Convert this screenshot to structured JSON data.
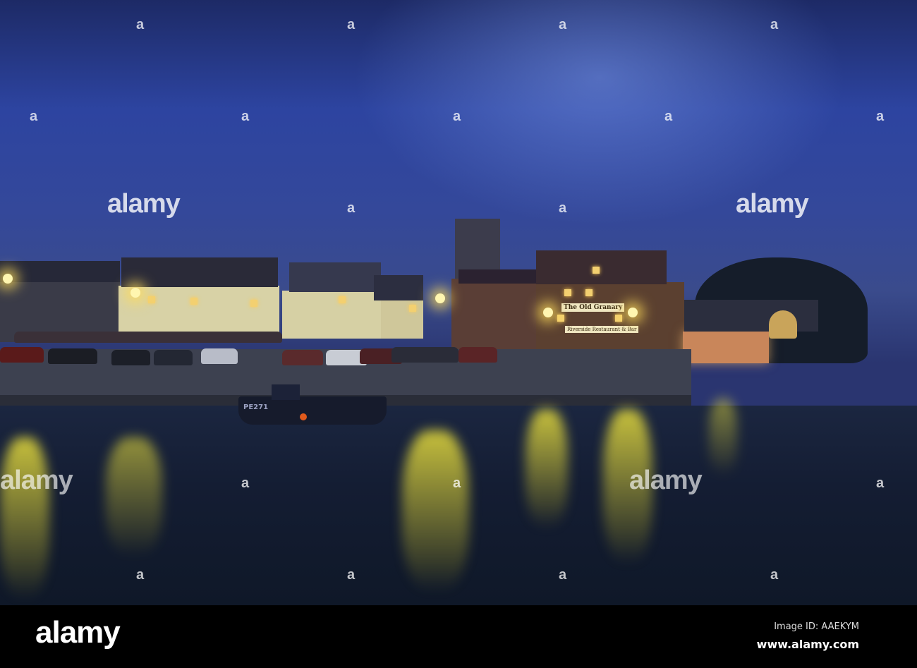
{
  "photo": {
    "subject": "Quayside at dusk",
    "pub_sign": "The Old Granary",
    "pub_subsign": "Riverside Restaurant & Bar",
    "boat_id": "PE271"
  },
  "watermark": {
    "text": "alamy",
    "corner_mark": "a"
  },
  "footer": {
    "logo": "alamy",
    "image_id": "Image ID: AAEKYM",
    "website": "www.alamy.com"
  },
  "colors": {
    "sky": "#2d44a0",
    "light": "#f3d070",
    "water": "#141d33",
    "footer_bg": "#000000"
  }
}
